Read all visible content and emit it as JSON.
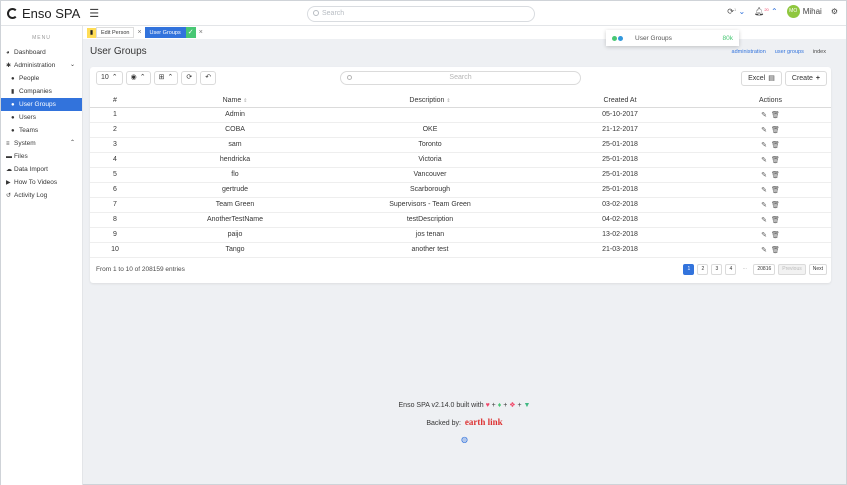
{
  "navbar": {
    "brand": "Enso SPA",
    "search_placeholder": "Search",
    "notif_count": "20",
    "user_initials": "MO",
    "user_name": "Mihai"
  },
  "sidebar": {
    "menu_label": "MENU",
    "items": [
      {
        "label": "Dashboard",
        "icon": "tachometer-icon"
      },
      {
        "label": "Administration",
        "icon": "users-cog-icon"
      },
      {
        "label": "People",
        "icon": "user-icon"
      },
      {
        "label": "Companies",
        "icon": "building-icon"
      },
      {
        "label": "User Groups",
        "icon": "users-icon"
      },
      {
        "label": "Users",
        "icon": "user-icon"
      },
      {
        "label": "Teams",
        "icon": "users-icon"
      },
      {
        "label": "System",
        "icon": "list-icon"
      },
      {
        "label": "Files",
        "icon": "folder-icon"
      },
      {
        "label": "Data Import",
        "icon": "cloud-upload-icon"
      },
      {
        "label": "How To Videos",
        "icon": "video-icon"
      },
      {
        "label": "Activity Log",
        "icon": "history-icon"
      }
    ]
  },
  "tabs": [
    {
      "label": "Edit Person"
    },
    {
      "label": "User Groups"
    }
  ],
  "toast": {
    "label": "User Groups",
    "value": "80k"
  },
  "page": {
    "title": "User Groups",
    "breadcrumbs": [
      "administration",
      "user groups",
      "index"
    ]
  },
  "table": {
    "per_page": "10",
    "search_placeholder": "Search",
    "excel_label": "Excel",
    "create_label": "Create",
    "columns": [
      "#",
      "Name",
      "Description",
      "Created At",
      "Actions"
    ],
    "rows": [
      {
        "n": "1",
        "name": "Admin",
        "desc": "",
        "created": "05-10-2017"
      },
      {
        "n": "2",
        "name": "COBA",
        "desc": "OKE",
        "created": "21-12-2017"
      },
      {
        "n": "3",
        "name": "sam",
        "desc": "Toronto",
        "created": "25-01-2018"
      },
      {
        "n": "4",
        "name": "hendricka",
        "desc": "Victoria",
        "created": "25-01-2018"
      },
      {
        "n": "5",
        "name": "flo",
        "desc": "Vancouver",
        "created": "25-01-2018"
      },
      {
        "n": "6",
        "name": "gertrude",
        "desc": "Scarborough",
        "created": "25-01-2018"
      },
      {
        "n": "7",
        "name": "Team Green",
        "desc": "Supervisors - Team Green",
        "created": "03-02-2018"
      },
      {
        "n": "8",
        "name": "AnotherTestName",
        "desc": "testDescription",
        "created": "04-02-2018"
      },
      {
        "n": "9",
        "name": "paijo",
        "desc": "jos tenan",
        "created": "13-02-2018"
      },
      {
        "n": "10",
        "name": "Tango",
        "desc": "another test",
        "created": "21-03-2018"
      }
    ],
    "summary": "From 1 to 10 of 208159 entries",
    "pages": [
      "1",
      "2",
      "3",
      "4",
      "...",
      "20816"
    ],
    "prev_label": "Previous",
    "next_label": "Next"
  },
  "footer": {
    "built_text": "Enso SPA v2.14.0 built with",
    "backed_text": "Backed by:",
    "sponsor": "earth link"
  },
  "colors": {
    "primary": "#3273dc",
    "success": "#48c774",
    "warning": "#ffdd57",
    "danger": "#f14668"
  }
}
